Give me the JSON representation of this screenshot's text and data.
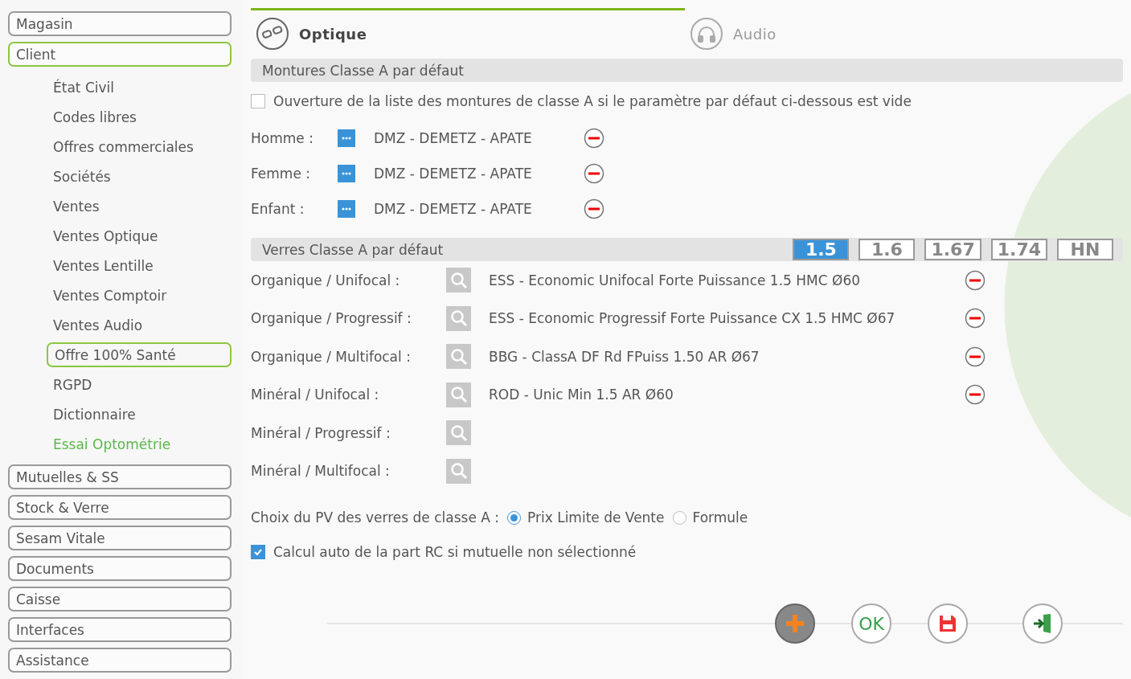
{
  "sidebar": {
    "items": [
      {
        "label": "Magasin",
        "selected": false
      },
      {
        "label": "Client",
        "selected": true,
        "children": [
          {
            "label": "État Civil",
            "selected": false,
            "accent": false
          },
          {
            "label": "Codes libres",
            "selected": false,
            "accent": false
          },
          {
            "label": "Offres commerciales",
            "selected": false,
            "accent": false
          },
          {
            "label": "Sociétés",
            "selected": false,
            "accent": false
          },
          {
            "label": "Ventes",
            "selected": false,
            "accent": false
          },
          {
            "label": "Ventes Optique",
            "selected": false,
            "accent": false
          },
          {
            "label": "Ventes Lentille",
            "selected": false,
            "accent": false
          },
          {
            "label": "Ventes Comptoir",
            "selected": false,
            "accent": false
          },
          {
            "label": "Ventes Audio",
            "selected": false,
            "accent": false
          },
          {
            "label": "Offre 100% Santé",
            "selected": true,
            "accent": false
          },
          {
            "label": "RGPD",
            "selected": false,
            "accent": false
          },
          {
            "label": "Dictionnaire",
            "selected": false,
            "accent": false
          },
          {
            "label": "Essai Optométrie",
            "selected": false,
            "accent": true
          }
        ]
      },
      {
        "label": "Mutuelles & SS",
        "selected": false
      },
      {
        "label": "Stock & Verre",
        "selected": false
      },
      {
        "label": "Sesam Vitale",
        "selected": false
      },
      {
        "label": "Documents",
        "selected": false
      },
      {
        "label": "Caisse",
        "selected": false
      },
      {
        "label": "Interfaces",
        "selected": false
      },
      {
        "label": "Assistance",
        "selected": false
      }
    ]
  },
  "tabs": [
    {
      "label": "Optique",
      "kind": "glasses",
      "selected": true
    },
    {
      "label": "Audio",
      "kind": "headphones",
      "selected": false
    }
  ],
  "frames": {
    "title": "Montures Classe A par défaut",
    "open_list": {
      "label": "Ouverture de la liste des montures de classe A si le paramètre par défaut ci-dessous est vide",
      "checked": false
    },
    "rows": [
      {
        "label": "Homme :",
        "value": "DMZ - DEMETZ - APATE"
      },
      {
        "label": "Femme :",
        "value": "DMZ - DEMETZ - APATE"
      },
      {
        "label": "Enfant :",
        "value": "DMZ - DEMETZ - APATE"
      }
    ]
  },
  "lenses": {
    "title": "Verres Classe A par défaut",
    "indices": [
      {
        "label": "1.5",
        "selected": true
      },
      {
        "label": "1.6",
        "selected": false
      },
      {
        "label": "1.67",
        "selected": false
      },
      {
        "label": "1.74",
        "selected": false
      },
      {
        "label": "HN",
        "selected": false
      }
    ],
    "rows": [
      {
        "label": "Organique / Unifocal :",
        "value": "ESS - Economic Unifocal Forte Puissance 1.5 HMC Ø60"
      },
      {
        "label": "Organique / Progressif :",
        "value": "ESS - Economic Progressif Forte Puissance CX 1.5 HMC Ø67"
      },
      {
        "label": "Organique / Multifocal :",
        "value": "BBG - ClassA DF Rd FPuiss 1.50 AR Ø67"
      },
      {
        "label": "Minéral / Unifocal :",
        "value": "ROD - Unic Min 1.5 AR Ø60"
      },
      {
        "label": "Minéral / Progressif :"
      },
      {
        "label": "Minéral / Multifocal :"
      }
    ]
  },
  "price_choice": {
    "label": "Choix du PV des verres de classe A :",
    "options": [
      {
        "label": "Prix Limite de Vente",
        "selected": true
      },
      {
        "label": "Formule",
        "selected": false
      }
    ]
  },
  "auto_rc": {
    "label": "Calcul auto de la part RC si mutuelle non sélectionné",
    "checked": true
  },
  "toolbar": [
    {
      "kind": "add"
    },
    {
      "kind": "ok",
      "label": "OK"
    },
    {
      "kind": "save"
    },
    {
      "kind": "exit"
    }
  ]
}
